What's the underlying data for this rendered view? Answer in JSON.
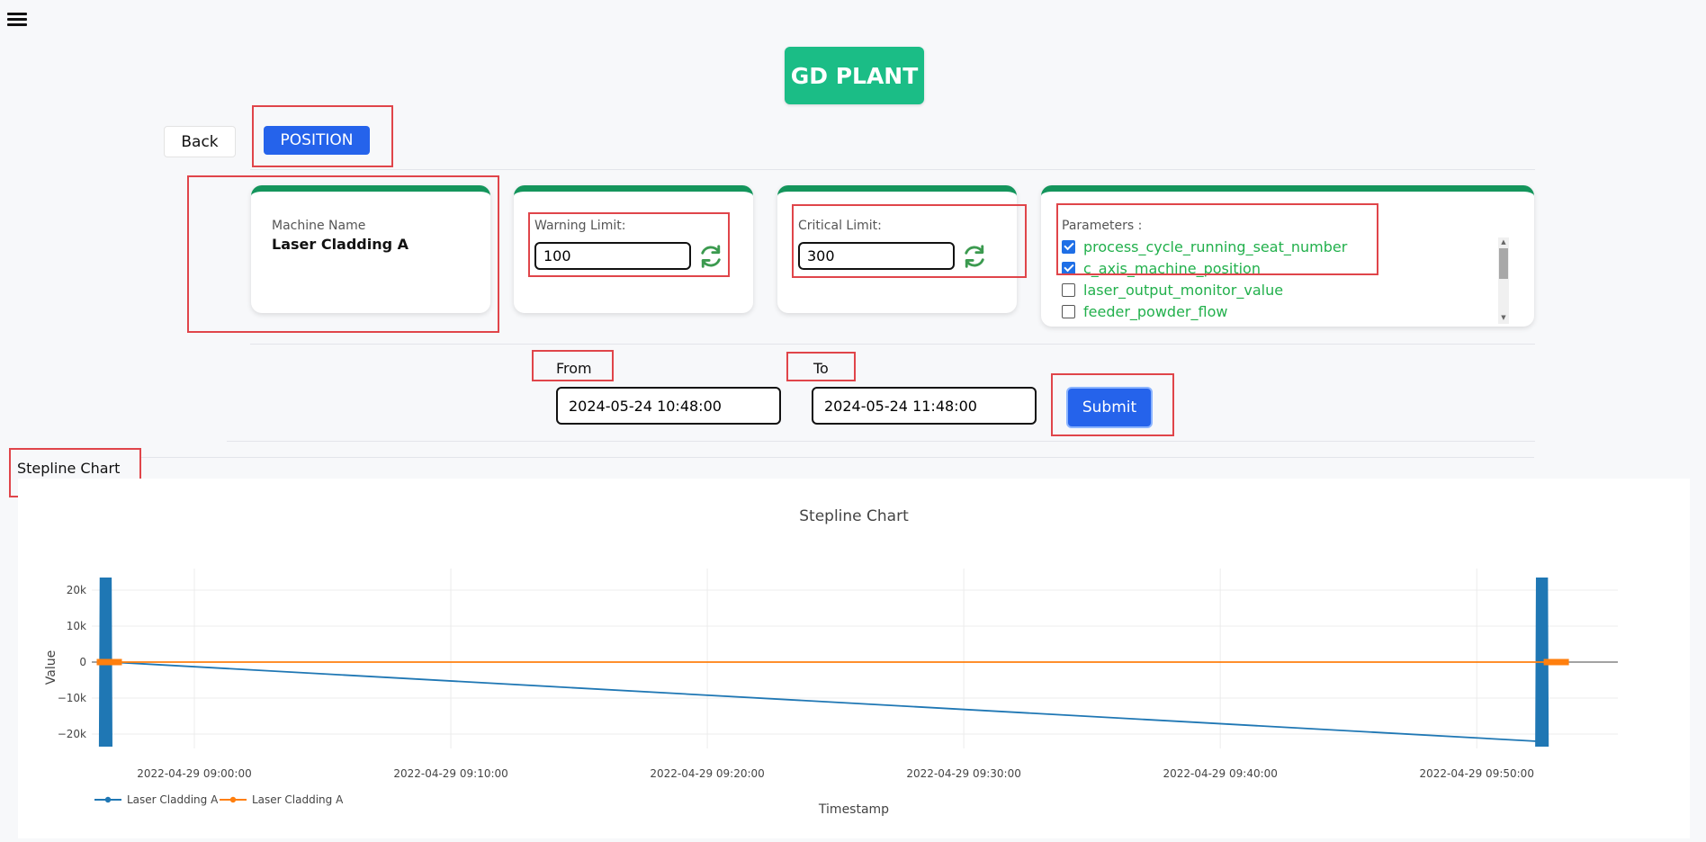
{
  "header": {
    "menu_icon": "hamburger-menu-icon",
    "plant_label": "GD PLANT"
  },
  "nav": {
    "back_label": "Back",
    "position_label": "POSITION"
  },
  "machine": {
    "label": "Machine Name",
    "name": "Laser Cladding A"
  },
  "warning": {
    "label": "Warning Limit:",
    "value": "100",
    "refresh_icon": "refresh-icon"
  },
  "critical": {
    "label": "Critical Limit:",
    "value": "300",
    "refresh_icon": "refresh-icon"
  },
  "parameters": {
    "label": "Parameters :",
    "items": [
      {
        "label": "process_cycle_running_seat_number",
        "checked": true
      },
      {
        "label": "c_axis_machine_position",
        "checked": true
      },
      {
        "label": "laser_output_monitor_value",
        "checked": false
      },
      {
        "label": "feeder_powder_flow",
        "checked": false
      }
    ]
  },
  "range": {
    "from_label": "From",
    "from_value": "2024-05-24 10:48:00",
    "to_label": "To",
    "to_value": "2024-05-24 11:48:00",
    "submit_label": "Submit"
  },
  "section_title": "Stepline Chart",
  "colors": {
    "accent_green": "#1bbd86",
    "card_border": "#14955c",
    "primary_blue": "#2563eb",
    "param_text": "#22b04c",
    "highlight_red": "#e0454a",
    "series_blue": "#1f77b4",
    "series_orange": "#ff7f0e"
  },
  "chart_data": {
    "type": "line",
    "title": "Stepline Chart",
    "xlabel": "Timestamp",
    "ylabel": "Value",
    "x_ticks": [
      "2022-04-29 09:00:00",
      "2022-04-29 09:10:00",
      "2022-04-29 09:20:00",
      "2022-04-29 09:30:00",
      "2022-04-29 09:40:00",
      "2022-04-29 09:50:00"
    ],
    "y_ticks": [
      "20k",
      "10k",
      "0",
      "−10k",
      "−20k"
    ],
    "ylim": [
      -24000,
      26000
    ],
    "x_range": [
      "2022-04-29 08:56:00",
      "2022-04-29 09:55:30"
    ],
    "grid": true,
    "legend_position": "bottom-left",
    "series": [
      {
        "name": "Laser Cladding A",
        "color": "#1f77b4",
        "note_clusters": [
          {
            "x_start": "2022-04-29 08:56:20",
            "x_end": "2022-04-29 08:56:45",
            "y_min": -23500,
            "y_max": 23500
          },
          {
            "x_start": "2022-04-29 09:52:20",
            "x_end": "2022-04-29 09:52:45",
            "y_min": -23500,
            "y_max": 23500
          }
        ],
        "points": [
          {
            "x": "2022-04-29 08:56:45",
            "y": 0
          },
          {
            "x": "2022-04-29 09:52:20",
            "y": -22000
          }
        ]
      },
      {
        "name": "Laser Cladding A",
        "color": "#ff7f0e",
        "points": [
          {
            "x": "2022-04-29 08:56:20",
            "y": 0
          },
          {
            "x": "2022-04-29 09:52:45",
            "y": 0
          }
        ]
      }
    ]
  }
}
